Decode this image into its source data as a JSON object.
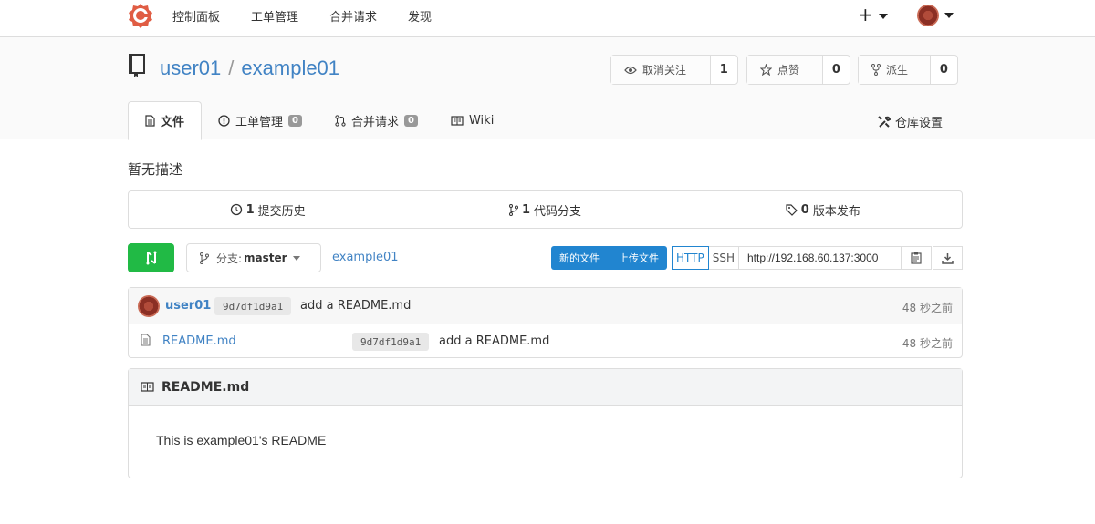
{
  "nav": {
    "items": [
      "控制面板",
      "工单管理",
      "合并请求",
      "发现"
    ],
    "plus": "+"
  },
  "repo": {
    "owner": "user01",
    "separator": "/",
    "name": "example01",
    "description": "暂无描述"
  },
  "actions": {
    "watch": {
      "label": "取消关注",
      "count": "1"
    },
    "star": {
      "label": "点赞",
      "count": "0"
    },
    "fork": {
      "label": "派生",
      "count": "0"
    }
  },
  "tabs": {
    "files": "文件",
    "issues": "工单管理",
    "issues_count": "0",
    "pulls": "合并请求",
    "pulls_count": "0",
    "wiki": "Wiki",
    "settings": "仓库设置"
  },
  "numbers": {
    "commits_count": "1",
    "commits_label": "提交历史",
    "branches_count": "1",
    "branches_label": "代码分支",
    "releases_count": "0",
    "releases_label": "版本发布"
  },
  "toolbar": {
    "branch_prefix": "分支:",
    "branch_name": "master",
    "breadcrumb": "example01",
    "new_file": "新的文件",
    "upload_file": "上传文件",
    "http": "HTTP",
    "ssh": "SSH",
    "clone_url": "http://192.168.60.137:3000"
  },
  "latest_commit": {
    "author": "user01",
    "sha": "9d7df1d9a1",
    "message": "add a README.md",
    "time": "48 秒之前"
  },
  "files": [
    {
      "name": "README.md",
      "sha": "9d7df1d9a1",
      "message": "add a README.md",
      "time": "48 秒之前"
    }
  ],
  "readme": {
    "title": "README.md",
    "content": "This is example01's README"
  },
  "colors": {
    "link": "#4183c4",
    "primary": "#2185d0",
    "green": "#21ba45"
  }
}
